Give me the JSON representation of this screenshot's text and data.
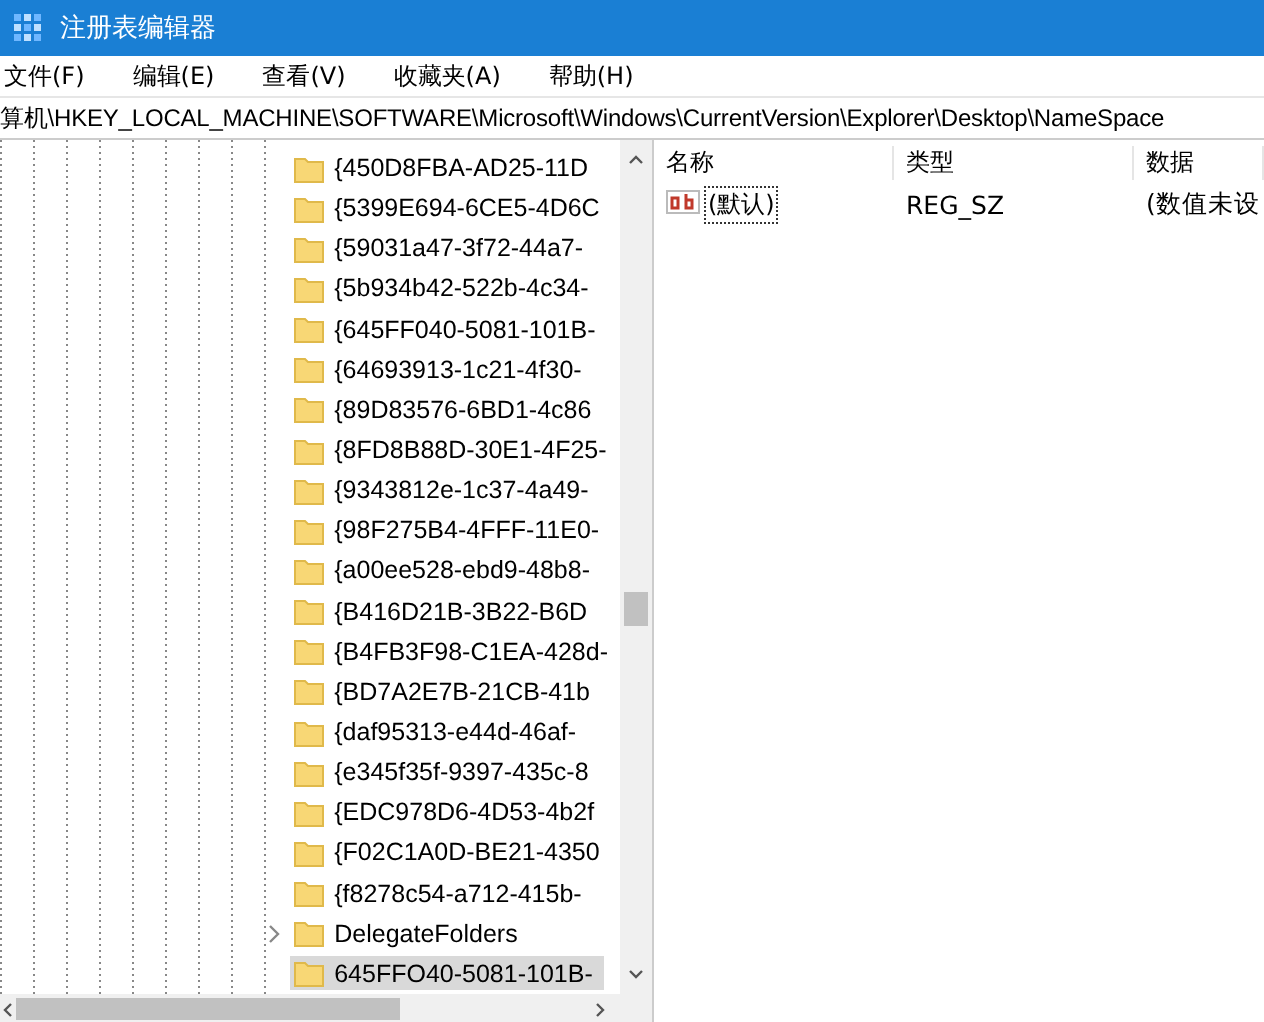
{
  "window": {
    "title": "注册表编辑器"
  },
  "menu": [
    "文件(F)",
    "编辑(E)",
    "查看(V)",
    "收藏夹(A)",
    "帮助(H)"
  ],
  "address": "算机\\HKEY_LOCAL_MACHINE\\SOFTWARE\\Microsoft\\Windows\\CurrentVersion\\Explorer\\Desktop\\NameSpace",
  "tree": [
    {
      "label": "{450D8FBA-AD25-11D",
      "expandable": false,
      "selected": false
    },
    {
      "label": "{5399E694-6CE5-4D6C",
      "expandable": false,
      "selected": false
    },
    {
      "label": "{59031a47-3f72-44a7-",
      "expandable": false,
      "selected": false
    },
    {
      "label": "{5b934b42-522b-4c34-",
      "expandable": false,
      "selected": false
    },
    {
      "label": "{645FF040-5081-101B-",
      "expandable": false,
      "selected": false
    },
    {
      "label": "{64693913-1c21-4f30-",
      "expandable": false,
      "selected": false
    },
    {
      "label": "{89D83576-6BD1-4c86",
      "expandable": false,
      "selected": false
    },
    {
      "label": "{8FD8B88D-30E1-4F25-",
      "expandable": false,
      "selected": false
    },
    {
      "label": "{9343812e-1c37-4a49-",
      "expandable": false,
      "selected": false
    },
    {
      "label": "{98F275B4-4FFF-11E0-",
      "expandable": false,
      "selected": false
    },
    {
      "label": "{a00ee528-ebd9-48b8-",
      "expandable": false,
      "selected": false
    },
    {
      "label": "{B416D21B-3B22-B6D",
      "expandable": false,
      "selected": false
    },
    {
      "label": "{B4FB3F98-C1EA-428d-",
      "expandable": false,
      "selected": false
    },
    {
      "label": "{BD7A2E7B-21CB-41b",
      "expandable": false,
      "selected": false
    },
    {
      "label": "{daf95313-e44d-46af-",
      "expandable": false,
      "selected": false
    },
    {
      "label": "{e345f35f-9397-435c-8",
      "expandable": false,
      "selected": false
    },
    {
      "label": "{EDC978D6-4D53-4b2f",
      "expandable": false,
      "selected": false
    },
    {
      "label": "{F02C1A0D-BE21-4350",
      "expandable": false,
      "selected": false
    },
    {
      "label": "{f8278c54-a712-415b-",
      "expandable": false,
      "selected": false
    },
    {
      "label": "DelegateFolders",
      "expandable": true,
      "selected": false
    },
    {
      "label": "645FFO40-5081-101B-",
      "expandable": false,
      "selected": true
    }
  ],
  "columns": [
    "名称",
    "类型",
    "数据"
  ],
  "values": [
    {
      "name": "(默认)",
      "type": "REG_SZ",
      "data": "(数值未设",
      "selected": true
    }
  ]
}
